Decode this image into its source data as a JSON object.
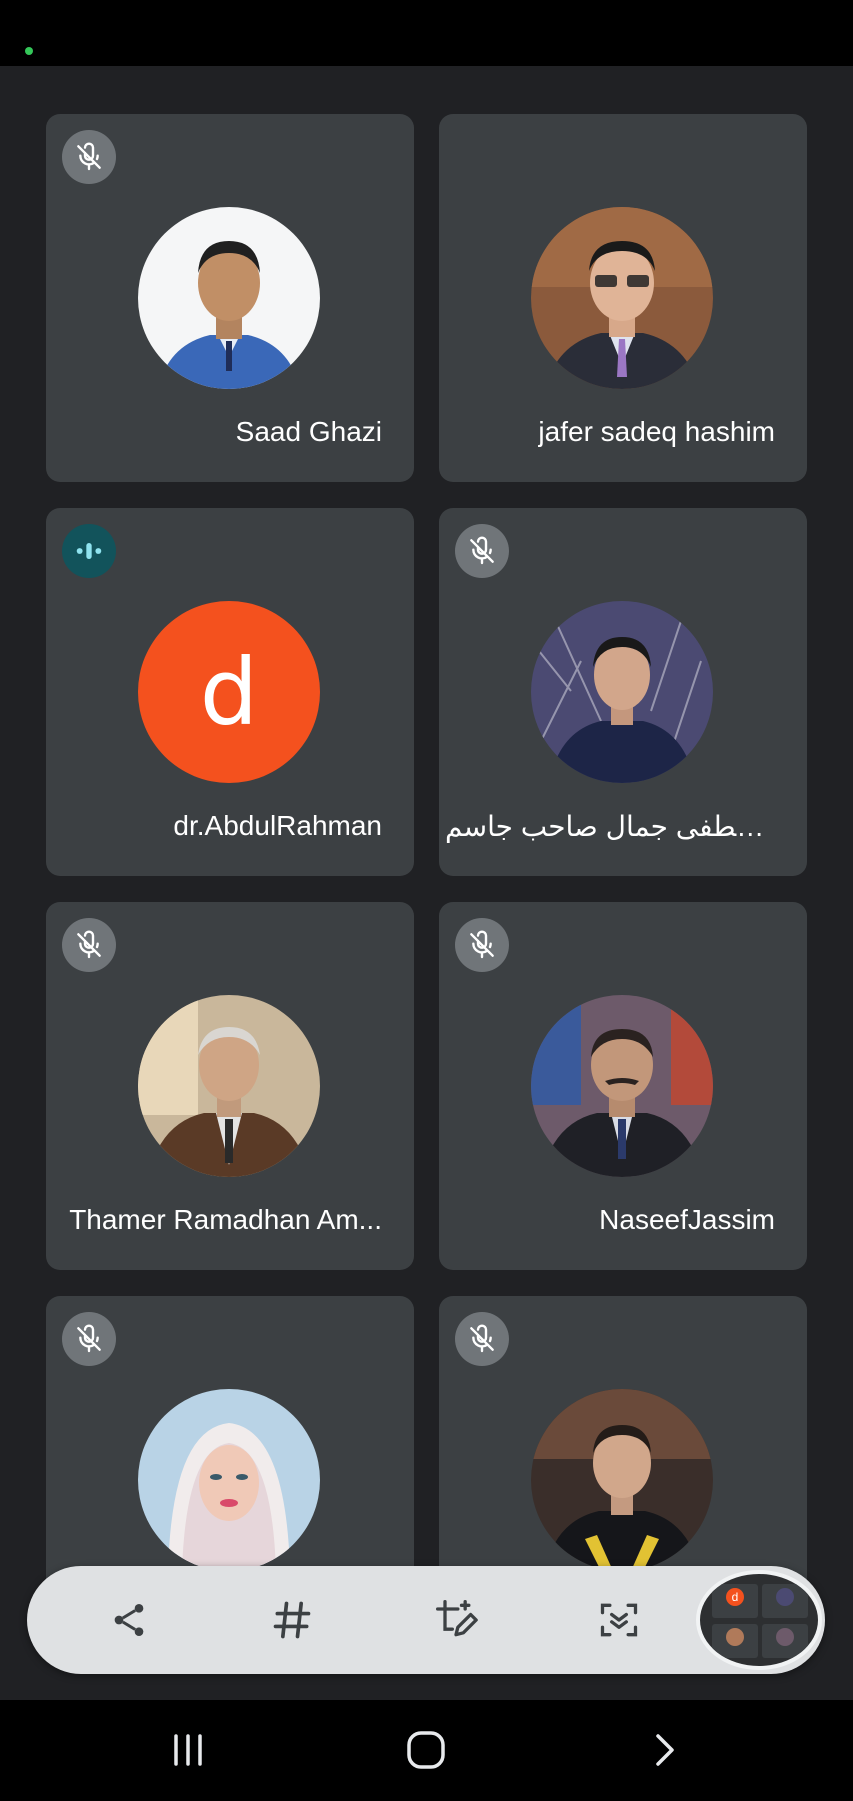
{
  "participants": [
    {
      "name": "Saad Ghazi",
      "mic": "muted",
      "avatar": "photo"
    },
    {
      "name": "jafer sadeq hashim",
      "mic": "none",
      "avatar": "photo"
    },
    {
      "name": "dr.AbdulRahman",
      "mic": "speaking",
      "avatar": "letter",
      "initial": "d",
      "avatar_color": "#f4511e"
    },
    {
      "name": "مصطفى جمال  صاحب جاسم",
      "mic": "muted",
      "avatar": "photo"
    },
    {
      "name": "Thamer Ramadhan Am...",
      "mic": "muted",
      "avatar": "photo"
    },
    {
      "name": "NaseefJassim",
      "mic": "muted",
      "avatar": "photo"
    },
    {
      "name": "",
      "mic": "muted",
      "avatar": "photo"
    },
    {
      "name": "",
      "mic": "muted",
      "avatar": "photo"
    }
  ],
  "toolbar": {
    "buttons": [
      "share-icon",
      "hashtag-icon",
      "crop-edit-icon",
      "scan-capture-icon"
    ],
    "preview_initial": "d"
  },
  "navigation": {
    "buttons": [
      "recent-apps-icon",
      "home-icon",
      "back-icon"
    ]
  },
  "colors": {
    "background": "#202124",
    "tile": "#3c4043",
    "speaking": "#12535b",
    "letter_avatar": "#f4511e"
  }
}
